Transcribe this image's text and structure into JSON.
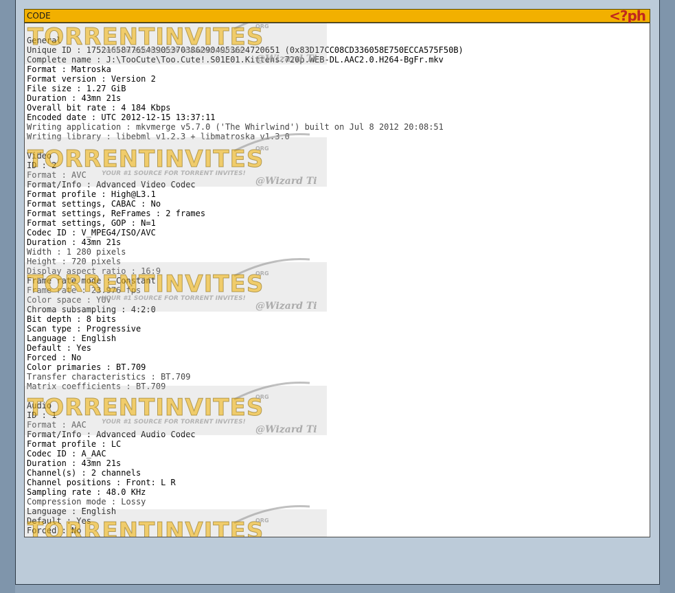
{
  "code_block": {
    "title": "CODE",
    "badge": "<?ph",
    "lines": [
      "General",
      "Unique ID : 175216587765439053703862904953624720651 (0x83D17CC08CD336058E750ECCA575F50B)",
      "Complete name : J:\\TooCute\\Too.Cute!.S01E01.Kittens.720p.WEB-DL.AAC2.0.H264-BgFr.mkv",
      "Format : Matroska",
      "Format version : Version 2",
      "File size : 1.27 GiB",
      "Duration : 43mn 21s",
      "Overall bit rate : 4 184 Kbps",
      "Encoded date : UTC 2012-12-15 13:37:11",
      "Writing application : mkvmerge v5.7.0 ('The Whirlwind') built on Jul 8 2012 20:08:51",
      "Writing library : libebml v1.2.3 + libmatroska v1.3.0",
      "",
      "Video",
      "ID : 2",
      "Format : AVC",
      "Format/Info : Advanced Video Codec",
      "Format profile : High@L3.1",
      "Format settings, CABAC : No",
      "Format settings, ReFrames : 2 frames",
      "Format settings, GOP : N=1",
      "Codec ID : V_MPEG4/ISO/AVC",
      "Duration : 43mn 21s",
      "Width : 1 280 pixels",
      "Height : 720 pixels",
      "Display aspect ratio : 16:9",
      "Frame rate mode : Constant",
      "Frame rate : 23.976 fps",
      "Color space : YUV",
      "Chroma subsampling : 4:2:0",
      "Bit depth : 8 bits",
      "Scan type : Progressive",
      "Language : English",
      "Default : Yes",
      "Forced : No",
      "Color primaries : BT.709",
      "Transfer characteristics : BT.709",
      "Matrix coefficients : BT.709",
      "",
      "Audio",
      "ID : 1",
      "Format : AAC",
      "Format/Info : Advanced Audio Codec",
      "Format profile : LC",
      "Codec ID : A_AAC",
      "Duration : 43mn 21s",
      "Channel(s) : 2 channels",
      "Channel positions : Front: L R",
      "Sampling rate : 48.0 KHz",
      "Compression mode : Lossy",
      "Language : English",
      "Default : Yes",
      "Forced : No"
    ]
  },
  "watermark": {
    "brand": "TORRENTINVITES",
    "org": "ORG",
    "tagline": "YOUR #1 SOURCE FOR TORRENT INVITES!",
    "signature": "@Wizard Ti"
  },
  "colors": {
    "header": "#f2b000",
    "panel": "#bccbd9",
    "frame": "#8ea3b8",
    "badge": "#c0281e"
  }
}
